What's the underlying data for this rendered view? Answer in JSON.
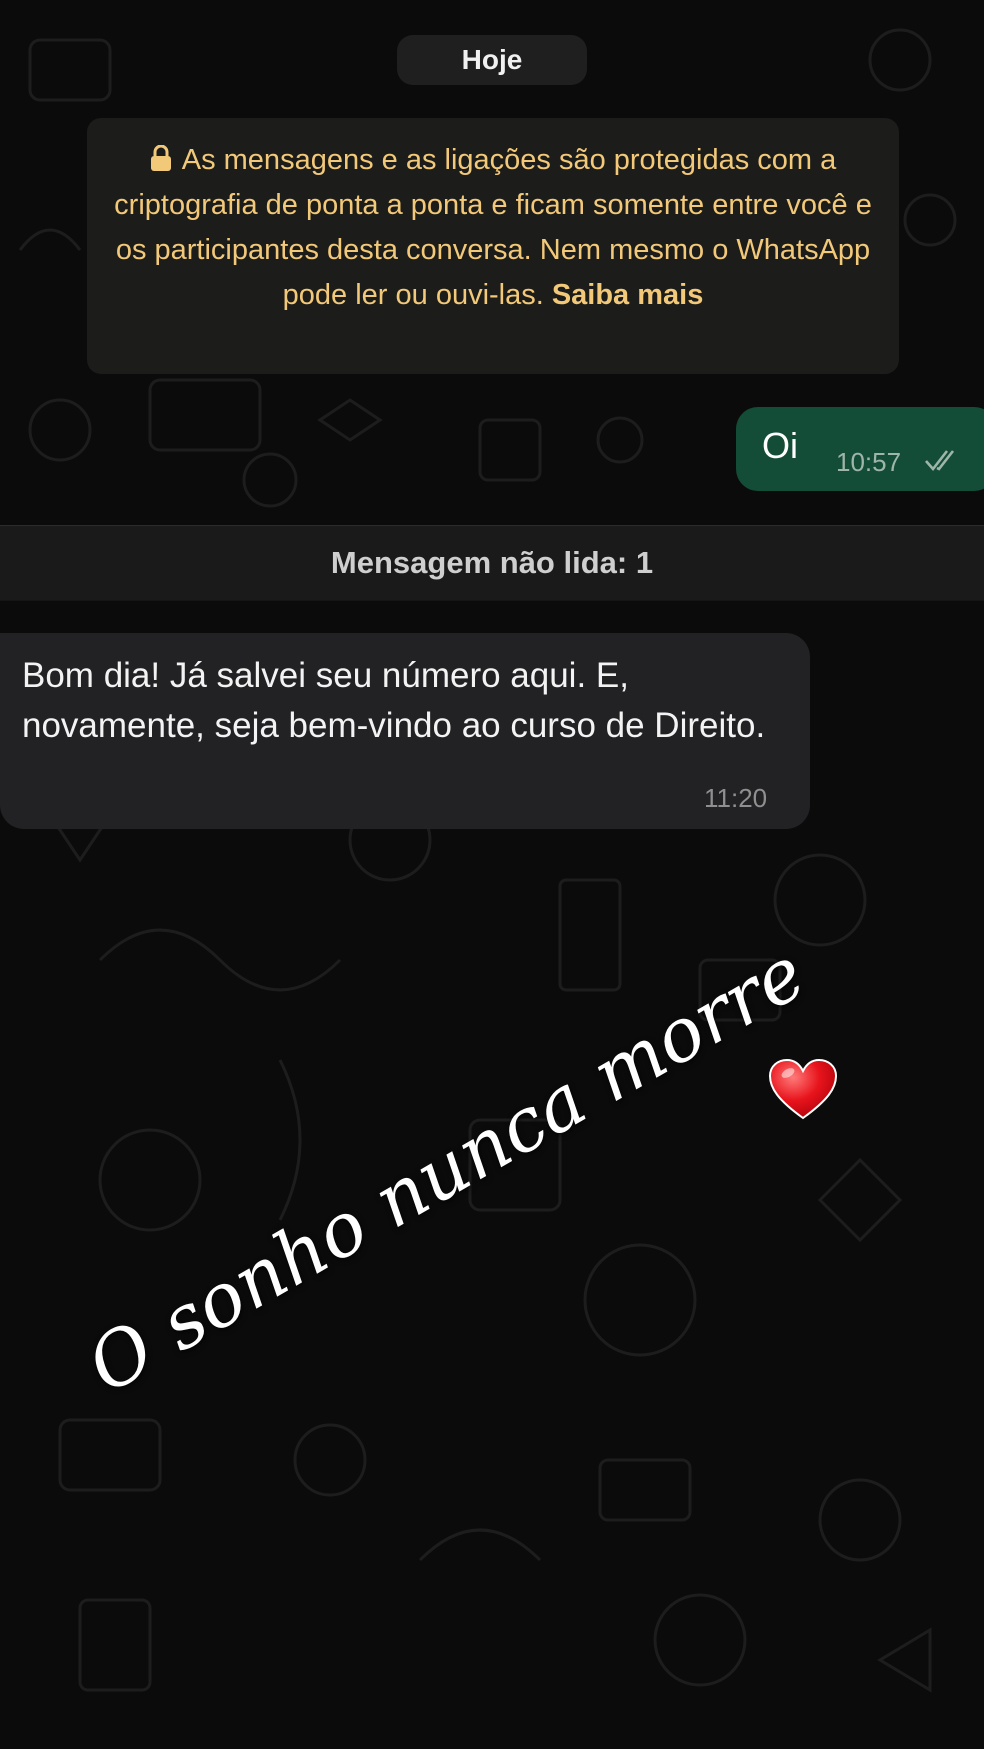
{
  "chat": {
    "date_separator": "Hoje",
    "encryption_notice": {
      "icon": "lock-icon",
      "text": "As mensagens e as ligações são protegidas com a criptografia de ponta a ponta e ficam somente entre você e os participantes desta conversa. Nem mesmo o WhatsApp pode ler ou ouvi-las.",
      "link": "Saiba mais"
    },
    "messages": [
      {
        "direction": "outgoing",
        "text": "Oi",
        "time": "10:57",
        "status_icon": "double-check-icon"
      },
      {
        "direction": "incoming",
        "text": "Bom dia! Já salvei seu número aqui. E, novamente, seja bem-vindo ao curso de Direito.",
        "time": "11:20"
      }
    ],
    "unread_banner": "Mensagem não lida: 1"
  },
  "overlay": {
    "caption": "O sonho nunca morre",
    "sticker_icon": "red-heart-icon"
  },
  "colors": {
    "background": "#0b0b0b",
    "outgoing_bubble": "#134d37",
    "incoming_bubble": "#222225",
    "notice_text": "#f2c879"
  }
}
